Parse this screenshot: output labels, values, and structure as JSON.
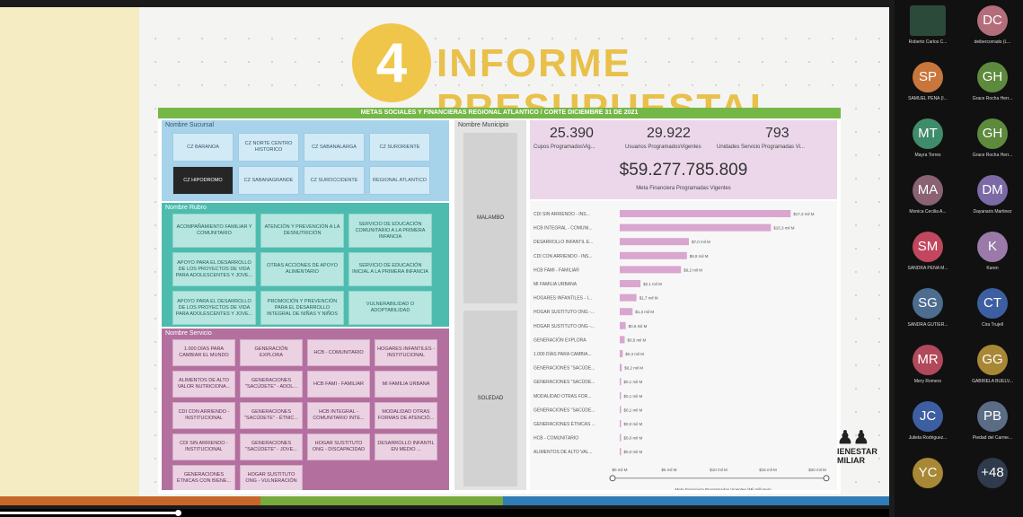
{
  "slide": {
    "number": "4",
    "title": "INFORME PRESUPUESTAL",
    "colors": {
      "yellow": "#f0c64a",
      "green": "#74b746",
      "blue": "#a7d3ea",
      "teal": "#4dbcae",
      "purple": "#b3709f",
      "pink": "#ecd7ea"
    }
  },
  "report": {
    "header": "METAS SOCIALES Y FINANCIERAS REGIONAL ATLANTICO / CORTE DICIEMBRE 31 DE 2021",
    "sucursal": {
      "label": "Nombre Sucursal",
      "items": [
        "CZ BARANOA",
        "CZ NORTE CENTRO HISTORICO",
        "CZ SABANALARGA",
        "CZ SURORIENTE",
        "CZ HIPODROMO",
        "CZ SABANAGRANDE",
        "CZ SUROCCIDENTE",
        "REGIONAL ATLANTICO"
      ],
      "selected": "CZ HIPODROMO"
    },
    "rubro": {
      "label": "Nombre Rubro",
      "items": [
        "ACOMPAÑAMIENTO FAMILIAR Y COMUNITARIO",
        "ATENCIÓN Y PREVENCIÓN A LA DESNUTRICIÓN",
        "SERVICIO DE EDUCACIÓN COMUNITARIO A LA PRIMERA INFANCIA",
        "APOYO PARA EL DESARROLLO DE LOS PROYECTOS DE VIDA PARA ADOLESCENTES Y JOVE...",
        "OTRAS ACCIONES DE APOYO ALIMENTARIO",
        "SERVICIO DE EDUCACIÓN INICIAL A LA PRIMERA INFANCIA",
        "APOYO PARA EL DESARROLLO DE LOS PROYECTOS DE VIDA PARA ADOLESCENTES Y JOVE...",
        "PROMOCIÓN Y PREVENCIÓN PARA EL DESARROLLO INTEGRAL DE NIÑAS Y NIÑOS",
        "VULNERABILIDAD O ADOPTABILIDAD"
      ]
    },
    "servicio": {
      "label": "Nombre Servicio",
      "items": [
        "1.000 DÍAS PARA CAMBIAR EL MUNDO",
        "GENERACIÓN EXPLORA",
        "HCB - COMUNITARIO",
        "HOGARES INFANTILES - INSTITUCIONAL",
        "ALIMENTOS DE ALTO VALOR NUTRICIONA...",
        "GENERACIONES \"SACÚDETE\" - ADOL...",
        "HCB FAMI - FAMILIAR",
        "MI FAMILIA URBANA",
        "CDI CON ARRIENDO - INSTITUCIONAL",
        "GENERACIONES \"SACÚDETE\" - ÉTNIC...",
        "HCB INTEGRAL - COMUNITARIO INTE...",
        "MODALIDAD OTRAS FORMAS DE ATENCIÓ...",
        "CDI SIN ARRIENDO - INSTITUCIONAL",
        "GENERACIONES \"SACÚDETE\" - JOVE...",
        "HOGAR SUSTITUTO ONG - DISCAPACIDAD",
        "DESARROLLO INFANTIL EN MEDIO ...",
        "GENERACIONES ÉTNICAS CON BIENE...",
        "HOGAR SUSTITUTO ONG - VULNERACIÓN"
      ]
    },
    "municipio": {
      "label": "Nombre Municipio",
      "items": [
        "MALAMBO",
        "SOLEDAD"
      ]
    },
    "kpis": [
      {
        "value": "25.390",
        "label": "Cupos ProgramadosVig..."
      },
      {
        "value": "29.922",
        "label": "Usuarios ProgramadosVigentes"
      },
      {
        "value": "793",
        "label": "Unidades Servicio Programadas Vi..."
      }
    ],
    "meta_total": "$59.277.785.809",
    "meta_total_label": "Meta Financiera Programadas Vigentes"
  },
  "chart_data": {
    "type": "bar",
    "orientation": "horizontal",
    "categories": [
      "CDI SIN ARRIENDO - INS...",
      "HCB INTEGRAL - COMUNI...",
      "DESARROLLO INFANTIL E...",
      "CDI CON ARRIENDO - INS...",
      "HCB FAMI - FAMILIAR",
      "MI FAMILIA URBANA",
      "HOGARES INFANTILES - I...",
      "HOGAR SUSTITUTO ONG -...",
      "HOGAR SUSTITUTO ONG -...",
      "GENERACIÓN EXPLORA",
      "1.000 DÍAS PARA CAMBIA...",
      "GENERACIONES \"SACÚDE...",
      "GENERACIONES \"SACÚDE...",
      "MODALIDAD OTRAS FOR...",
      "GENERACIONES \"SACÚDE...",
      "GENERACIONES ÉTNICAS ...",
      "HCB - COMUNITARIO",
      "ALIMENTOS DE ALTO VAL..."
    ],
    "values": [
      17.3,
      15.3,
      7.0,
      6.8,
      6.2,
      2.1,
      1.7,
      1.3,
      0.6,
      0.5,
      0.3,
      0.2,
      0.1,
      0.1,
      0.1,
      0.0,
      0.0,
      0.0
    ],
    "value_labels": [
      "$17,3 mil M",
      "$15,3 mil M",
      "$7,0 mil M",
      "$6,8 mil M",
      "$6,2 mil M",
      "$2,1 mil M",
      "$1,7 mil M",
      "$1,3 mil M",
      "$0,6 mil M",
      "$0,5 mil M",
      "$0,3 mil M",
      "$0,2 mil M",
      "$0,1 mil M",
      "$0,1 mil M",
      "$0,1 mil M",
      "$0,0 mil M",
      "$0,0 mil M",
      "$0,0 mil M"
    ],
    "xticks": [
      "$0 mil M",
      "$5 mil M",
      "$10 mil M",
      "$15 mil M",
      "$20 mil M"
    ],
    "xlim": [
      0,
      20
    ],
    "xlabel": "Meta Financiera Programadas Vigentes (Mil millones)",
    "bar_color": "#d9a6d0"
  },
  "logo": {
    "line1": "IENESTAR",
    "line2": "MILIAR"
  },
  "participants": [
    {
      "name": "Roberto Carlos C...",
      "initials": "",
      "color": "#2c4a3a",
      "video": true
    },
    {
      "name": "deibercorrado (L...",
      "initials": "DC",
      "color": "#b46d7a"
    },
    {
      "name": "SAMUEL PEÑA (I...",
      "initials": "SP",
      "color": "#c8763b"
    },
    {
      "name": "Grace Rocha Herr...",
      "initials": "GH",
      "color": "#5d8a3c"
    },
    {
      "name": "Mayra Torres",
      "initials": "MT",
      "color": "#3f8c6b"
    },
    {
      "name": "Grace Rocha Herr...",
      "initials": "GH",
      "color": "#5d8a3c"
    },
    {
      "name": "Monica Cecilia A...",
      "initials": "MA",
      "color": "#8a6272"
    },
    {
      "name": "Dayanaris Martinez",
      "initials": "DM",
      "color": "#7c6aa6"
    },
    {
      "name": "SANDRA PEÑA M...",
      "initials": "SM",
      "color": "#c0475e"
    },
    {
      "name": "Karen",
      "initials": "K",
      "color": "#9a7aa8"
    },
    {
      "name": "SANDRA GUTIER...",
      "initials": "SG",
      "color": "#4c6c90"
    },
    {
      "name": "Cira Trujell",
      "initials": "CT",
      "color": "#3d5fa2"
    },
    {
      "name": "Mery Romero",
      "initials": "MR",
      "color": "#b2495a"
    },
    {
      "name": "GABRIELA BUELV...",
      "initials": "GG",
      "color": "#a88735"
    },
    {
      "name": "Julieta Rodriguez...",
      "initials": "JC",
      "color": "#3d5fa2"
    },
    {
      "name": "Piedad del Carme...",
      "initials": "PB",
      "color": "#5b6c86"
    },
    {
      "name": "",
      "initials": "YC",
      "color": "#a88735"
    },
    {
      "name": "",
      "initials": "+48",
      "color": "#2f3a4c"
    }
  ],
  "video_progress": 0.2
}
